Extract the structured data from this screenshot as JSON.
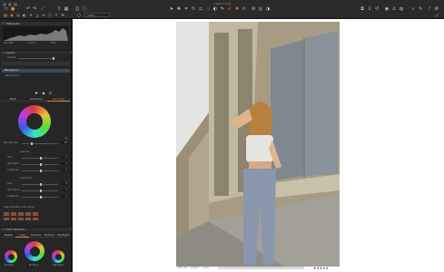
{
  "window": {
    "title": "Capture One"
  },
  "toolbar": {
    "zoom_value": "100%"
  },
  "panels": {
    "histogram": {
      "title": "Histogram",
      "iso": "ISO 100",
      "aperture": "f/2.8",
      "shutter": "1/125 s"
    },
    "layers": {
      "title": "Layers",
      "opacity_label": "Opacity",
      "layer_items": [
        "Background"
      ],
      "bottom_items": [
        "Background"
      ]
    },
    "color_balance": {
      "tabs": [
        "Basic",
        "Advanced",
        "Skin Tone"
      ],
      "smoothness_label": "Smoothness",
      "amount_label": "Amount",
      "uniformity_label": "Uniformity",
      "hue_label": "Hue",
      "saturation_label": "Saturation",
      "lightness_label": "Lightness",
      "values": {
        "smoothness": "20",
        "hue": "0",
        "saturation": "0",
        "lightness": "0",
        "u_hue": "0",
        "u_saturation": "0",
        "u_lightness": "0"
      }
    },
    "selected_range": {
      "title": "View selected color range"
    },
    "color_balance2": {
      "title": "Color Balance",
      "tabs": [
        "Master",
        "3-Way",
        "Shadow",
        "Midtone",
        "Highlight"
      ],
      "wheel_labels": [
        "Shadow",
        "Midtone",
        "Highlight"
      ]
    }
  },
  "status": {
    "iso": "ISO 100",
    "shutter": "1/250 s",
    "aperture": "f/2.8",
    "filename": "",
    "rating_stars": "★★★★★"
  },
  "colors": {
    "accent": "#e8893a",
    "panel_bg": "#262626",
    "viewer_bg": "#ffffff"
  },
  "icons": [
    "back-icon",
    "forward-icon",
    "rotate-icon",
    "crop-icon",
    "cursor-icon",
    "pan-icon",
    "picker-icon",
    "brush-icon",
    "eraser-icon",
    "grid-icon",
    "compare-icon",
    "export-icon",
    "search-icon",
    "settings-icon",
    "eye-icon",
    "undo-icon"
  ]
}
